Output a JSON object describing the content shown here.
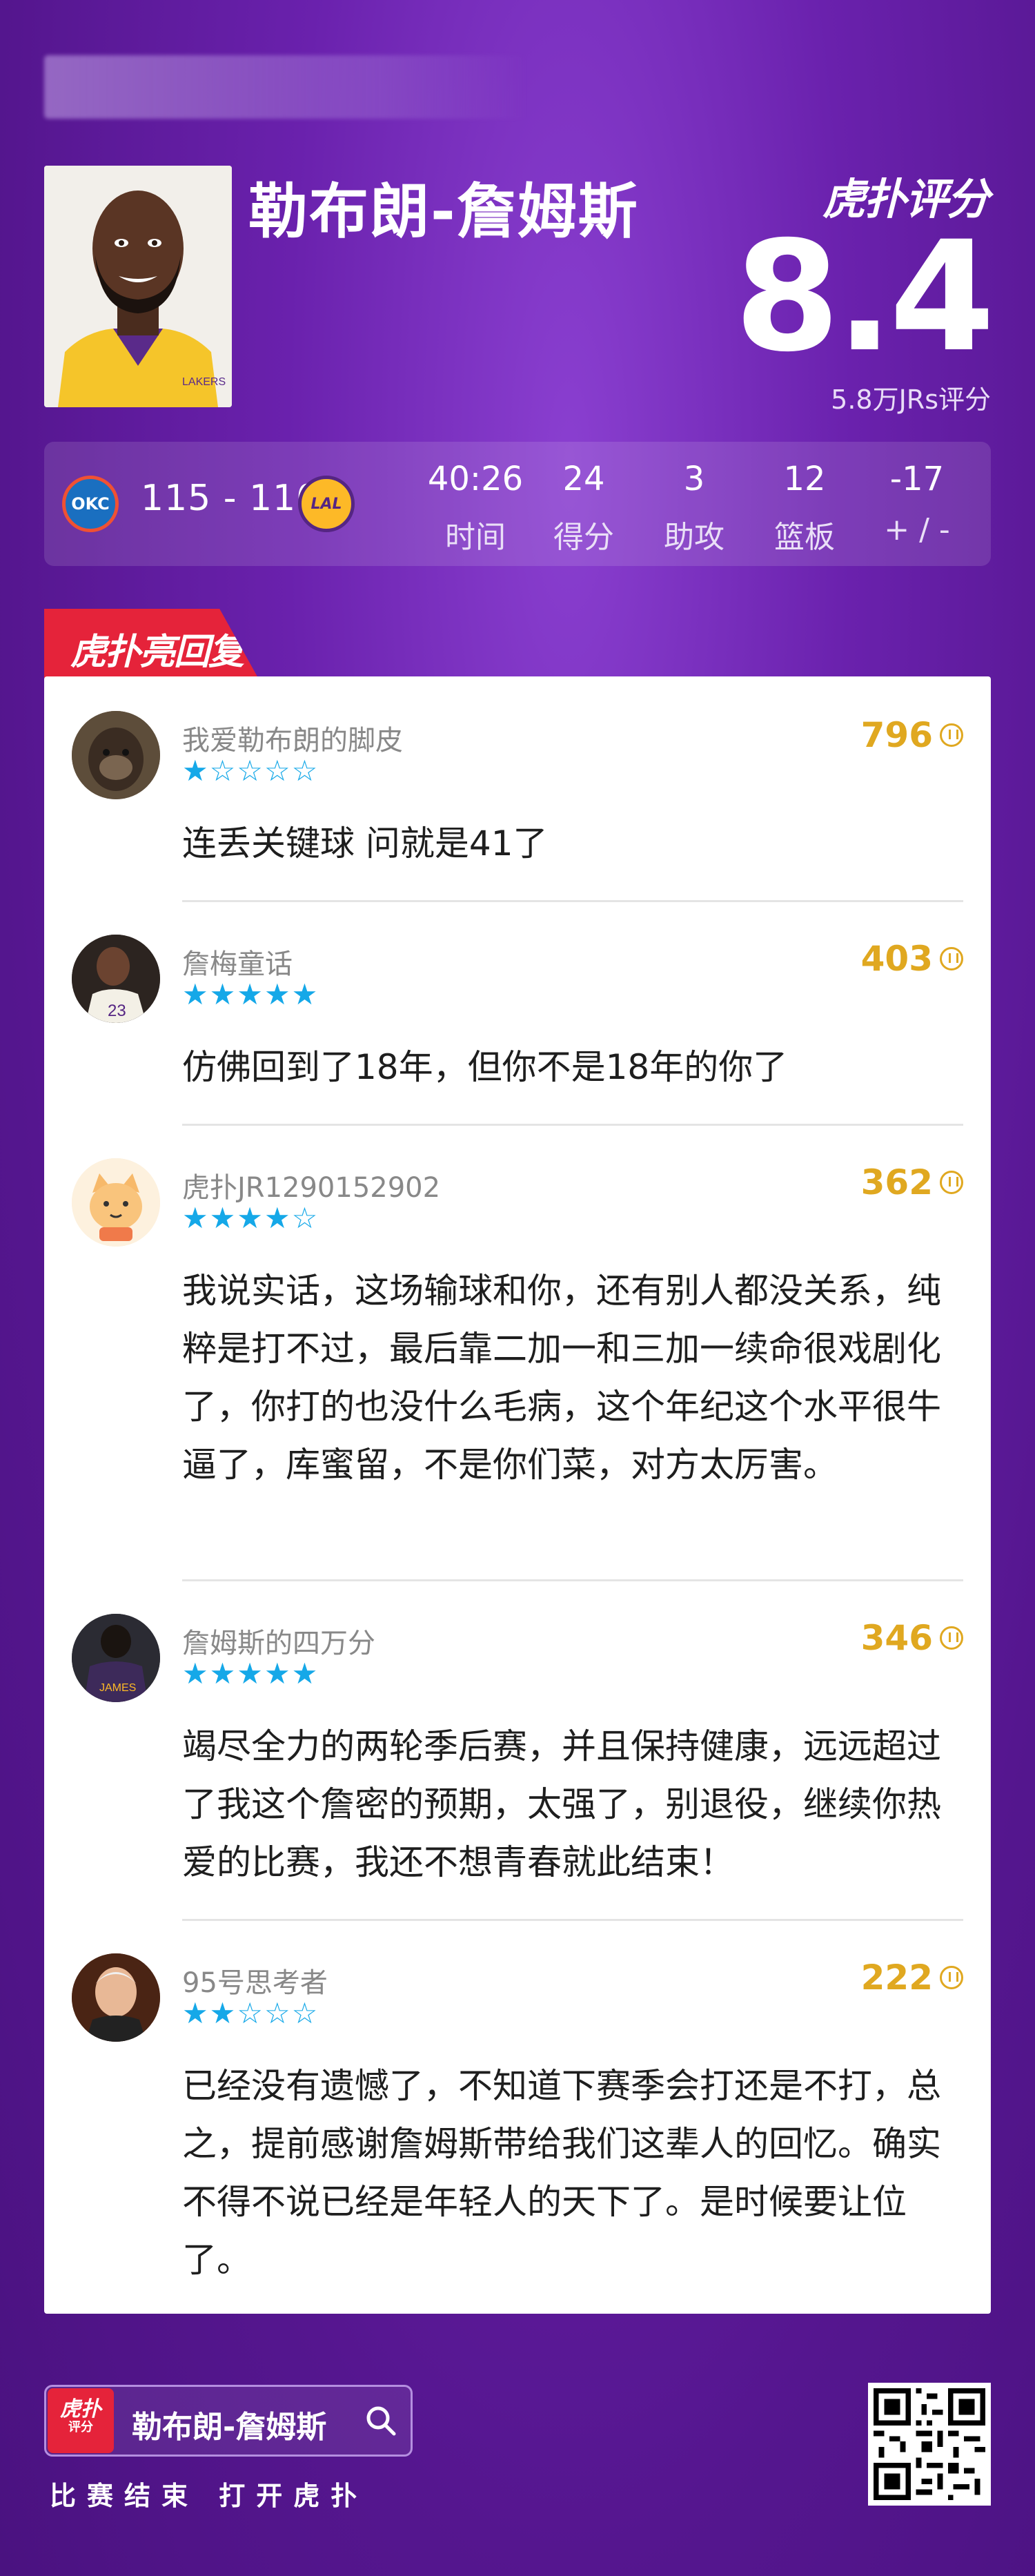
{
  "top_blur_text": "",
  "player": {
    "name": "勒布朗-詹姆斯"
  },
  "brand": {
    "logo_text": "虎扑评分"
  },
  "rating": {
    "score": "8.4",
    "count": "5.8万JRs评分"
  },
  "game": {
    "home_team": "OKC",
    "away_team": "LAL",
    "score": "115 - 110",
    "stats": [
      {
        "value": "40:26",
        "label": "时间"
      },
      {
        "value": "24",
        "label": "得分"
      },
      {
        "value": "3",
        "label": "助攻"
      },
      {
        "value": "12",
        "label": "篮板"
      },
      {
        "value": "-17",
        "label": "+ / -"
      }
    ]
  },
  "section": {
    "title": "虎扑亮回复"
  },
  "comments": [
    {
      "user": "我爱勒布朗的脚皮",
      "stars": 1,
      "likes": "796",
      "text": "连丢关键球 问就是41了"
    },
    {
      "user": "詹梅童话",
      "stars": 5,
      "likes": "403",
      "text": "仿佛回到了18年，但你不是18年的你了"
    },
    {
      "user": "虎扑JR1290152902",
      "stars": 4,
      "likes": "362",
      "text": "我说实话，这场输球和你，还有别人都没关系，纯粹是打不过，最后靠二加一和三加一续命很戏剧化了，你打的也没什么毛病，这个年纪这个水平很牛逼了，库蜜留，不是你们菜，对方太厉害。"
    },
    {
      "user": "詹姆斯的四万分",
      "stars": 5,
      "likes": "346",
      "text": "竭尽全力的两轮季后赛，并且保持健康，远远超过了我这个詹密的预期，太强了，别退役，继续你热爱的比赛，我还不想青春就此结束！"
    },
    {
      "user": "95号思考者",
      "stars": 2,
      "likes": "222",
      "text": "已经没有遗憾了，不知道下赛季会打还是不打，总之，提前感谢詹姆斯带给我们这辈人的回忆。确实不得不说已经是年轻人的天下了。是时候要让位了。"
    }
  ],
  "footer": {
    "logo_text": "虎扑",
    "logo_sub": "评分",
    "search_name": "勒布朗-詹姆斯",
    "tagline": "比赛结束 打开虎扑"
  }
}
